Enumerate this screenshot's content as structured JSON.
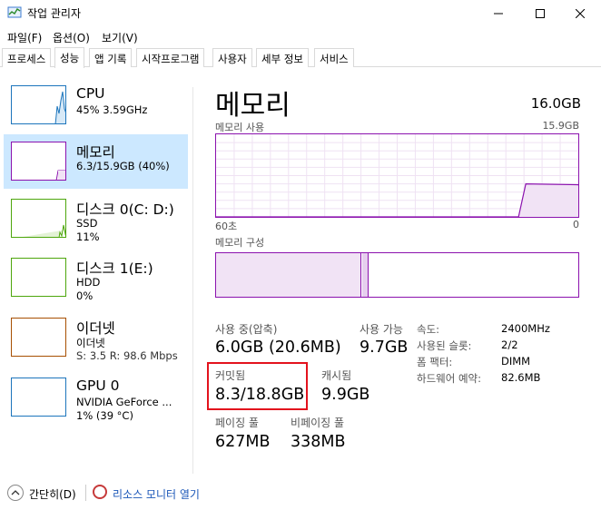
{
  "window": {
    "title": "작업 관리자"
  },
  "menu": {
    "items": [
      "파일(F)",
      "옵션(O)",
      "보기(V)"
    ]
  },
  "tabs": [
    "프로세스",
    "성능",
    "앱 기록",
    "시작프로그램",
    "사용자",
    "세부 정보",
    "서비스"
  ],
  "active_tab": "성능",
  "sidebar": {
    "items": [
      {
        "name": "CPU",
        "sub1": "45%  3.59GHz",
        "sub2": "",
        "sub3": "",
        "color": "#1c75bc",
        "icon": "cpu-graph-icon"
      },
      {
        "name": "메모리",
        "sub1": "6.3/15.9GB (40%)",
        "sub2": "",
        "sub3": "",
        "color": "#8b12ae",
        "icon": "memory-graph-icon"
      },
      {
        "name": "디스크 0(C: D:)",
        "sub1": "SSD",
        "sub2": "11%",
        "sub3": "",
        "color": "#4da60c",
        "icon": "disk-graph-icon"
      },
      {
        "name": "디스크 1(E:)",
        "sub1": "HDD",
        "sub2": "0%",
        "sub3": "",
        "color": "#4da60c",
        "icon": "disk-graph-icon"
      },
      {
        "name": "이더넷",
        "sub1": "이더넷",
        "sub2": "S: 3.5  R: 98.6 Mbps",
        "sub3": "",
        "color": "#a74f01",
        "icon": "ethernet-graph-icon"
      },
      {
        "name": "GPU 0",
        "sub1": "NVIDIA GeForce ...",
        "sub2": "1% (39 °C)",
        "sub3": "",
        "color": "#1c75bc",
        "icon": "gpu-graph-icon"
      }
    ]
  },
  "main": {
    "title": "메모리",
    "total": "16.0GB",
    "usage_graph": {
      "label": "메모리 사용",
      "max_label": "15.9GB",
      "x_left_label": "60초",
      "x_right_label": "0",
      "current_fraction": 0.4
    },
    "composition": {
      "label": "메모리 구성",
      "in_use_fraction": 0.4
    },
    "stats": {
      "in_use_label": "사용 중(압축)",
      "in_use_value": "6.0GB (20.6MB)",
      "available_label": "사용 가능",
      "available_value": "9.7GB",
      "committed_label": "커밋됨",
      "committed_value": "8.3/18.8GB",
      "cached_label": "캐시됨",
      "cached_value": "9.9GB",
      "paged_label": "페이징 풀",
      "paged_value": "627MB",
      "nonpaged_label": "비페이징 풀",
      "nonpaged_value": "338MB"
    },
    "specs": [
      {
        "key": "속도:",
        "value": "2400MHz"
      },
      {
        "key": "사용된 슬롯:",
        "value": "2/2"
      },
      {
        "key": "폼 팩터:",
        "value": "DIMM"
      },
      {
        "key": "하드웨어 예약:",
        "value": "82.6MB"
      }
    ]
  },
  "footer": {
    "collapse_label": "간단히(D)",
    "resource_monitor_label": "리소스 모니터 열기"
  },
  "colors": {
    "memory_accent": "#8b12ae",
    "highlight": "#e3131d",
    "link": "#1a56b8",
    "selected_bg": "#cce8ff"
  }
}
